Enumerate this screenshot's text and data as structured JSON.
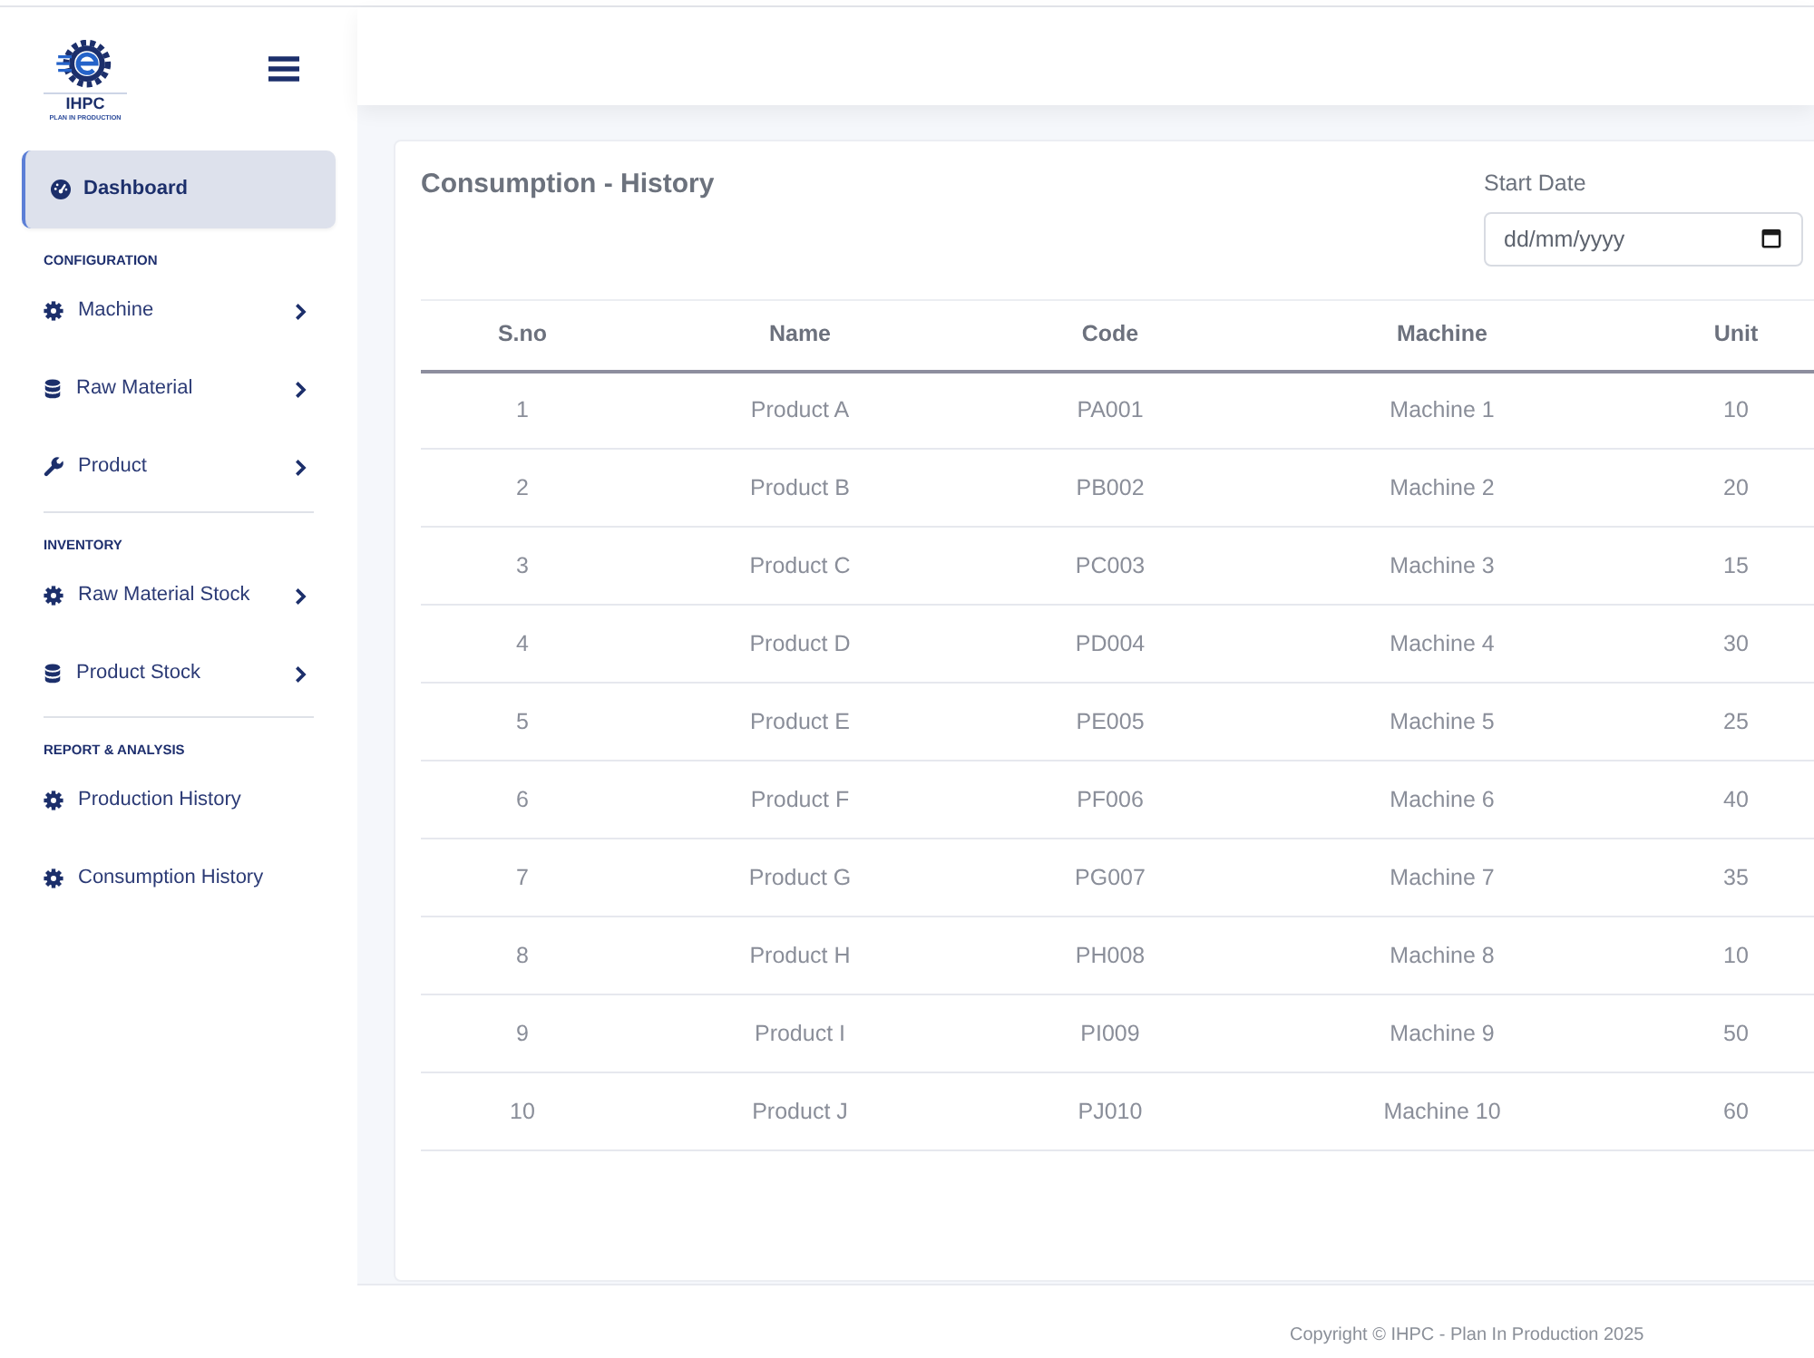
{
  "brand": {
    "name": "IHPC",
    "tagline": "PLAN IN PRODUCTION"
  },
  "sidebar": {
    "dashboard": {
      "label": "Dashboard",
      "selected": true
    },
    "sections": [
      {
        "heading": "CONFIGURATION",
        "items": [
          {
            "label": "Machine",
            "kind": "submenu",
            "selected": false
          },
          {
            "label": "Raw Material",
            "kind": "submenu",
            "selected": false
          },
          {
            "label": "Product",
            "kind": "submenu",
            "selected": false
          }
        ]
      },
      {
        "heading": "INVENTORY",
        "items": [
          {
            "label": "Raw Material Stock",
            "kind": "submenu",
            "selected": false
          },
          {
            "label": "Product Stock",
            "kind": "submenu",
            "selected": false
          }
        ]
      },
      {
        "heading": "REPORT & ANALYSIS",
        "items": [
          {
            "label": "Production History",
            "kind": "link",
            "selected": false
          },
          {
            "label": "Consumption History",
            "kind": "link",
            "selected": false
          }
        ]
      }
    ]
  },
  "page": {
    "title": "Consumption - History",
    "filter": {
      "label": "Start Date",
      "placeholder": "dd/mm/yyyy"
    },
    "table": {
      "columns": [
        "S.no",
        "Name",
        "Code",
        "Machine",
        "Unit"
      ],
      "rows": [
        [
          "1",
          "Product A",
          "PA001",
          "Machine 1",
          "10"
        ],
        [
          "2",
          "Product B",
          "PB002",
          "Machine 2",
          "20"
        ],
        [
          "3",
          "Product C",
          "PC003",
          "Machine 3",
          "15"
        ],
        [
          "4",
          "Product D",
          "PD004",
          "Machine 4",
          "30"
        ],
        [
          "5",
          "Product E",
          "PE005",
          "Machine 5",
          "25"
        ],
        [
          "6",
          "Product F",
          "PF006",
          "Machine 6",
          "40"
        ],
        [
          "7",
          "Product G",
          "PG007",
          "Machine 7",
          "35"
        ],
        [
          "8",
          "Product H",
          "PH008",
          "Machine 8",
          "10"
        ],
        [
          "9",
          "Product I",
          "PI009",
          "Machine 9",
          "50"
        ],
        [
          "10",
          "Product J",
          "PJ010",
          "Machine 10",
          "60"
        ]
      ]
    }
  },
  "footer": {
    "text": "Copyright © IHPC - Plan In Production 2025"
  }
}
